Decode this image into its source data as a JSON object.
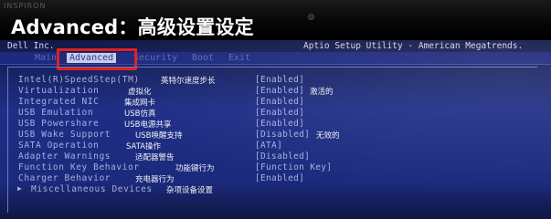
{
  "bezel": {
    "brand": "INSPIRON"
  },
  "caption": "Advanced：高级设置设定",
  "header": {
    "vendor": "Dell Inc.",
    "utility": "Aptio Setup Utility - American Megatrends."
  },
  "tabs": [
    {
      "label": "Main",
      "active": false
    },
    {
      "label": "Advanced",
      "active": true
    },
    {
      "label": "Security",
      "active": false
    },
    {
      "label": "Boot",
      "active": false
    },
    {
      "label": "Exit",
      "active": false
    }
  ],
  "options": [
    {
      "label": "Intel(R)SpeedStep(TM)",
      "note": "英特尔速度步长",
      "value": "[Enabled]",
      "value_note": ""
    },
    {
      "label": "Virtualization",
      "note": "虚拟化",
      "value": "[Enabled]",
      "value_note": "激活的"
    },
    {
      "label": "Integrated NIC",
      "note": "集成网卡",
      "value": "[Enabled]",
      "value_note": ""
    },
    {
      "label": "USB Emulation",
      "note": "USB仿真",
      "value": "[Enabled]",
      "value_note": ""
    },
    {
      "label": "USB Powershare",
      "note": "USB电源共享",
      "value": "[Enabled]",
      "value_note": ""
    },
    {
      "label": "USB Wake Support",
      "note": "USB唤醒支持",
      "value": "[Disabled]",
      "value_note": "无效的"
    },
    {
      "label": "SATA Operation",
      "note": "SATA操作",
      "value": "[ATA]",
      "value_note": ""
    },
    {
      "label": "Adapter Warnings",
      "note": "适配器警告",
      "value": "[Disabled]",
      "value_note": ""
    },
    {
      "label": "Function Key Behavior",
      "note": "功能键行为",
      "value": "[Function Key]",
      "value_note": ""
    },
    {
      "label": "Charger Behavior",
      "note": "充电器行为",
      "value": "[Enabled]",
      "value_note": ""
    }
  ],
  "submenu": {
    "arrow": "▶",
    "label": "Miscellaneous Devices",
    "note": "杂项设备设置"
  },
  "colors": {
    "bios_blue": "#1f2e86",
    "text": "#a8b0e0",
    "highlight_box": "#e02020",
    "caption": "#ffffff"
  }
}
